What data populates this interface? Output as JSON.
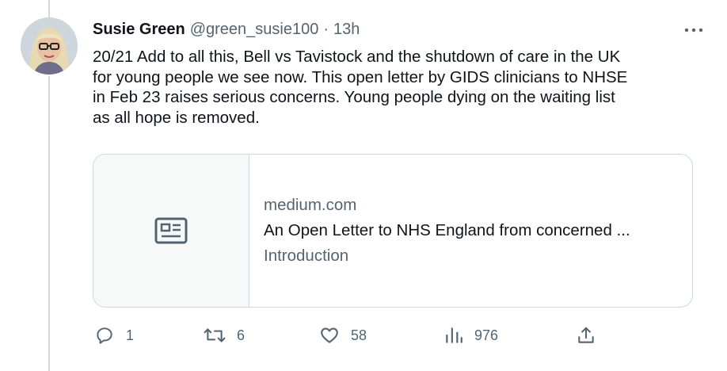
{
  "tweet": {
    "author_name": "Susie Green",
    "author_handle": "@green_susie100",
    "separator": "·",
    "time": "13h",
    "text": "20/21 Add to all this, Bell vs Tavistock and the shutdown of care in the UK\nfor young people we see now. This open letter by GIDS clinicians to NHSE\nin Feb 23 raises serious concerns. Young people dying on the waiting list\nas all hope is removed.",
    "more_icon": "more-horizontal-icon"
  },
  "link_card": {
    "domain": "medium.com",
    "title": "An Open Letter to NHS England from concerned ...",
    "description": "Introduction",
    "thumbnail_icon": "article-icon"
  },
  "actions": {
    "replies": "1",
    "retweets": "6",
    "likes": "58",
    "views": "976"
  },
  "colors": {
    "text_primary": "#0f1419",
    "text_secondary": "#536471",
    "border": "#cfd9de",
    "card_thumb_bg": "#f7f9f9"
  }
}
